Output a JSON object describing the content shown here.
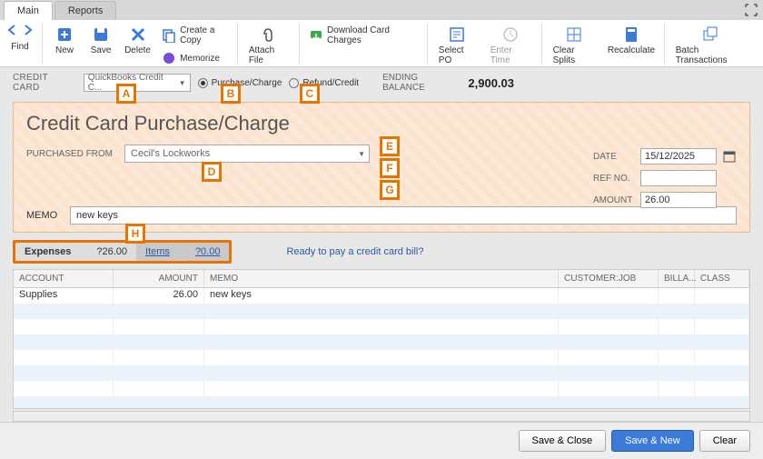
{
  "tabs": {
    "main": "Main",
    "reports": "Reports"
  },
  "toolbar": {
    "find": "Find",
    "new": "New",
    "save": "Save",
    "delete": "Delete",
    "create_copy": "Create a Copy",
    "memorize": "Memorize",
    "attach_file": "Attach File",
    "download_charges": "Download Card Charges",
    "select_po": "Select PO",
    "enter_time": "Enter Time",
    "clear_splits": "Clear Splits",
    "recalculate": "Recalculate",
    "batch_transactions": "Batch Transactions"
  },
  "cc_row": {
    "label": "CREDIT CARD",
    "selected": "QuickBooks Credit C...",
    "purchase_charge": "Purchase/Charge",
    "refund_credit": "Refund/Credit",
    "ending_balance_label": "ENDING BALANCE",
    "ending_balance": "2,900.03"
  },
  "check": {
    "title": "Credit Card Purchase/Charge",
    "purchased_from_label": "PURCHASED FROM",
    "purchased_from": "Cecil's Lockworks",
    "date_label": "DATE",
    "date": "15/12/2025",
    "refno_label": "REF NO.",
    "refno": "",
    "amount_label": "AMOUNT",
    "amount": "26.00",
    "memo_label": "MEMO",
    "memo": "new keys"
  },
  "subtabs": {
    "expenses_label": "Expenses",
    "expenses_amount": "?26.00",
    "items_label": "Items",
    "items_amount": "?0.00",
    "ready_link": "Ready to pay a credit card bill?"
  },
  "grid": {
    "headers": {
      "account": "ACCOUNT",
      "amount": "AMOUNT",
      "memo": "MEMO",
      "customer": "CUSTOMER:JOB",
      "billable": "BILLA...",
      "class": "CLASS"
    },
    "rows": [
      {
        "account": "Supplies",
        "amount": "26.00",
        "memo": "new keys",
        "customer": "",
        "billable": "",
        "class": ""
      }
    ]
  },
  "footer": {
    "save_close": "Save & Close",
    "save_new": "Save & New",
    "clear": "Clear"
  },
  "annotations": {
    "a": "A",
    "b": "B",
    "c": "C",
    "d": "D",
    "e": "E",
    "f": "F",
    "g": "G",
    "h": "H"
  }
}
